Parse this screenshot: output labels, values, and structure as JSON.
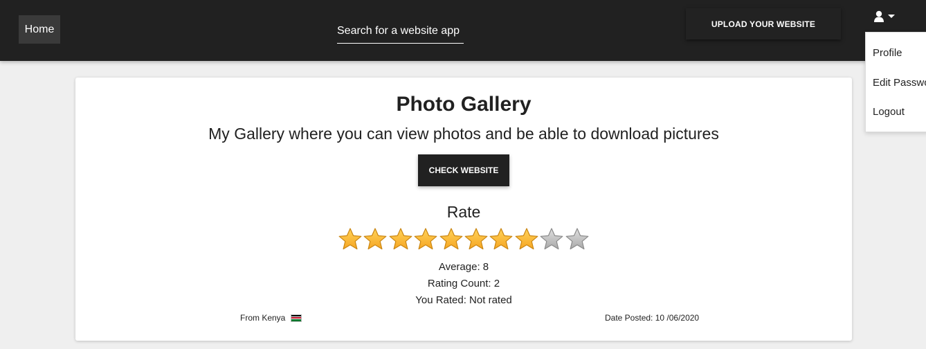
{
  "navbar": {
    "home_label": "Home",
    "search_placeholder": "Search for a website app",
    "upload_label": "UPLOAD YOUR WEBSITE",
    "user_icon": "user-icon"
  },
  "user_menu": {
    "items": [
      "Profile",
      "Edit Password",
      "Logout"
    ]
  },
  "project": {
    "title": "Photo Gallery",
    "description": "My Gallery where you can view photos and be able to download pictures",
    "check_label": "CHECK WEBSITE",
    "rate_label": "Rate",
    "rating": {
      "filled": 8,
      "total": 10
    },
    "average": "Average: 8",
    "rating_count": "Rating Count: 2",
    "you_rated": "You Rated: Not rated",
    "from": "From Kenya",
    "flag_icon": "kenya-flag-icon",
    "date_posted": "Date Posted: 10 /06/2020"
  },
  "colors": {
    "navbar": "#212121",
    "star_filled": "#f6a623",
    "star_empty": "#a9a9a9",
    "page_bg": "#efefef"
  }
}
